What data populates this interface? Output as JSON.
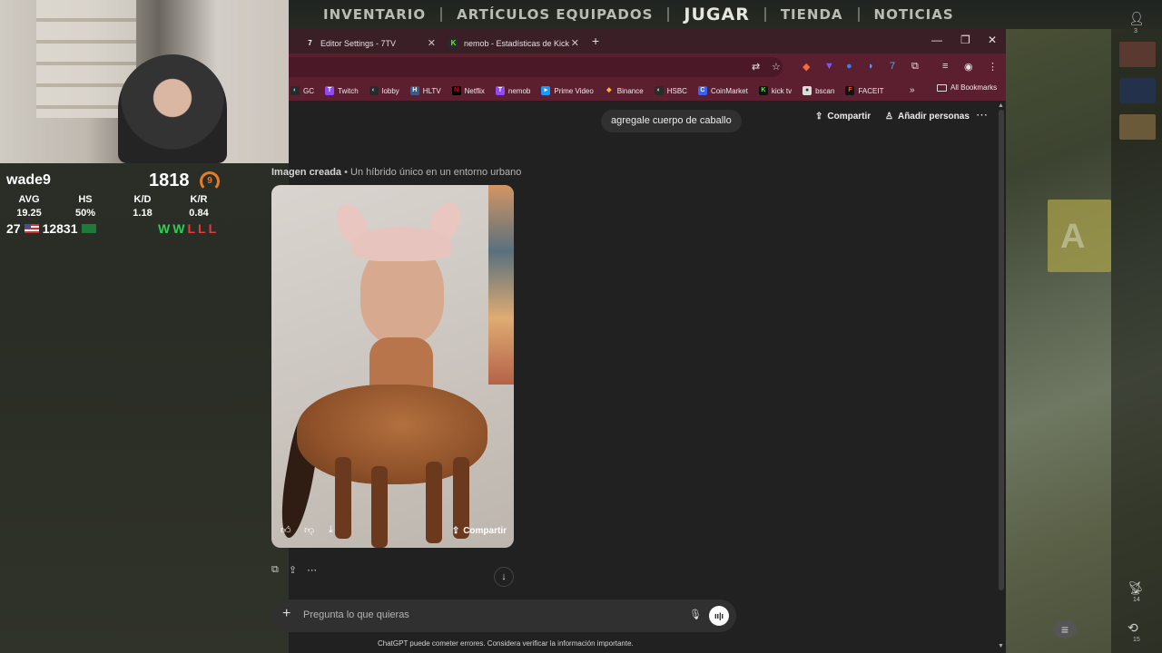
{
  "game": {
    "nav": [
      "INVENTARIO",
      "ARTÍCULOS EQUIPADOS",
      "JUGAR",
      "TIENDA",
      "NOTICIAS"
    ],
    "wall_letter": "A",
    "rail": {
      "friends_count": "3",
      "signal": "14",
      "history": "15"
    }
  },
  "stats": {
    "name": "wade9",
    "elo": "1818",
    "level": "9",
    "headers": [
      "AVG",
      "HS",
      "K/D",
      "K/R"
    ],
    "values": [
      "19.25",
      "50%",
      "1.18",
      "0.84"
    ],
    "matches": "27",
    "elo_needed": "12831",
    "results": [
      "W",
      "W",
      "L",
      "L",
      "L"
    ],
    "colors": {
      "win": "#2fce54",
      "loss": "#e8383a",
      "level": "#e97b25"
    }
  },
  "browser": {
    "tabs": [
      {
        "title": "Editor Settings - 7TV",
        "icon": "7tv-icon"
      },
      {
        "title": "nemob - Estadísticas de Kick",
        "icon": "kick-icon"
      }
    ],
    "bookmarks": [
      "GC",
      "Twitch",
      "lobby",
      "HLTV",
      "Netflix",
      "nemob",
      "Prime Video",
      "Binance",
      "HSBC",
      "CoinMarket",
      "kick tv",
      "bscan",
      "FACEIT"
    ],
    "all_bookmarks": "All Bookmarks",
    "theme_color": "#5b1f2f"
  },
  "chat": {
    "user_message": "agregale cuerpo de caballo",
    "share_label": "Compartir",
    "add_people_label": "Añadir personas",
    "image_caption_bold": "Imagen creada",
    "image_caption": "• Un híbrido único en un entorno urbano",
    "image_share_label": "Compartir",
    "composer_placeholder": "Pregunta lo que quieras",
    "disclaimer": "ChatGPT puede cometer errores. Considera verificar la información importante."
  }
}
